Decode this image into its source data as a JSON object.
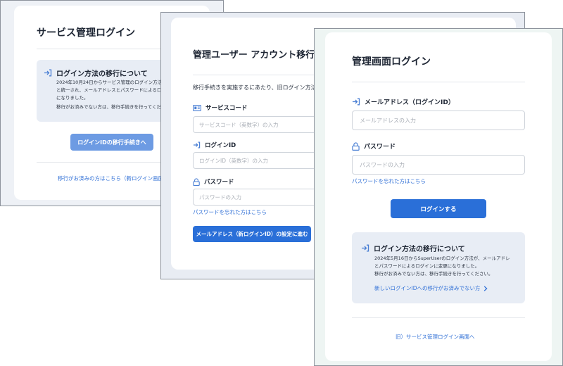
{
  "window1": {
    "title": "サービス管理ログイン",
    "info": {
      "heading": "ログイン方法の移行について",
      "line1": "2024年10月24日からサービス管理のログイン方法がSuper",
      "line2": "と統一され、メールアドレスとパスワードによるログイン",
      "line3": "になりました。",
      "line4": "移行がお済みでない方は、移行手続きを行ってください"
    },
    "button_label": "ログインIDの移行手続きへ",
    "footer_link": "移行がお済みの方はこちら（新ログイン画面へ"
  },
  "window2": {
    "title": "管理ユーザー アカウント移行手続",
    "intro": "移行手続きを実施するにあたり、旧ログイン方法で",
    "service_code": {
      "label": "サービスコード",
      "placeholder": "サービスコード（英数字）の入力"
    },
    "login_id": {
      "label": "ログインID",
      "placeholder": "ログインID（英数字）の入力"
    },
    "password": {
      "label": "パスワード",
      "placeholder": "パスワードの入力"
    },
    "forgot_link": "パスワードを忘れた方はこちら",
    "button_label": "メールアドレス（新ログインID）の設定に進む"
  },
  "window3": {
    "title": "管理画面ログイン",
    "email": {
      "label": "メールアドレス（ログインID）",
      "placeholder": "メールアドレスの入力"
    },
    "password": {
      "label": "パスワード",
      "placeholder": "パスワードの入力"
    },
    "forgot_link": "パスワードを忘れた方はこちら",
    "login_button": "ログインする",
    "info": {
      "heading": "ログイン方法の移行について",
      "line1": "2024年5月16日からSuperUserのログイン方法が、メールアドレ",
      "line2": "とパスワードによるログインに変更になりました。",
      "line3": "移行がお済みでない方は、移行手続きを行ってください。",
      "link": "新しいログインIDへの移行がお済みでない方"
    },
    "footer_link": "旧）サービス管理ログイン画面へ"
  },
  "colors": {
    "accent": "#2a6fd8",
    "accent_muted": "#6d9be3",
    "window1_bg": "#eef1f6",
    "window2_bg": "#e8ecf3",
    "window3_bg": "#eef5f3",
    "info_bg": "#e8edf5",
    "icon_blue": "#4a7fd4"
  }
}
